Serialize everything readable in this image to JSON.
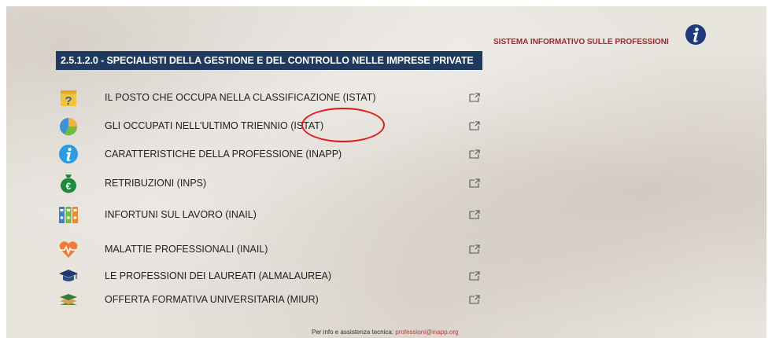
{
  "header": {
    "title": "2.5.1.2.0 - SPECIALISTI DELLA GESTIONE E DEL CONTROLLO NELLE IMPRESE PRIVATE"
  },
  "system": {
    "title": "SISTEMA INFORMATIVO SULLE PROFESSIONI",
    "info_icon": "info-icon"
  },
  "items": [
    {
      "label": "IL POSTO CHE OCCUPA NELLA CLASSIFICAZIONE (ISTAT)",
      "icon": "question-icon"
    },
    {
      "label": "GLI OCCUPATI NELL'ULTIMO TRIENNIO (ISTAT)",
      "icon": "pie-chart-icon"
    },
    {
      "label": "CARATTERISTICHE DELLA PROFESSIONE (INAPP)",
      "icon": "info-icon"
    },
    {
      "label": "RETRIBUZIONI (INPS)",
      "icon": "euro-bag-icon"
    },
    {
      "label": "INFORTUNI SUL LAVORO (INAIL)",
      "icon": "binders-icon"
    },
    {
      "label": "MALATTIE PROFESSIONALI (INAIL)",
      "icon": "heart-pulse-icon"
    },
    {
      "label": "LE PROFESSIONI DEI LAUREATI (ALMALAUREA)",
      "icon": "graduation-cap-icon"
    },
    {
      "label": "OFFERTA FORMATIVA UNIVERSITARIA (MIUR)",
      "icon": "books-icon"
    }
  ],
  "footer": {
    "text": "Per info e assistenza tecnica: ",
    "email": "professioni@inapp.org"
  },
  "colors": {
    "header_bg": "#1f3a5f",
    "accent_red": "#a0282c",
    "annotation_red": "#e01818"
  }
}
